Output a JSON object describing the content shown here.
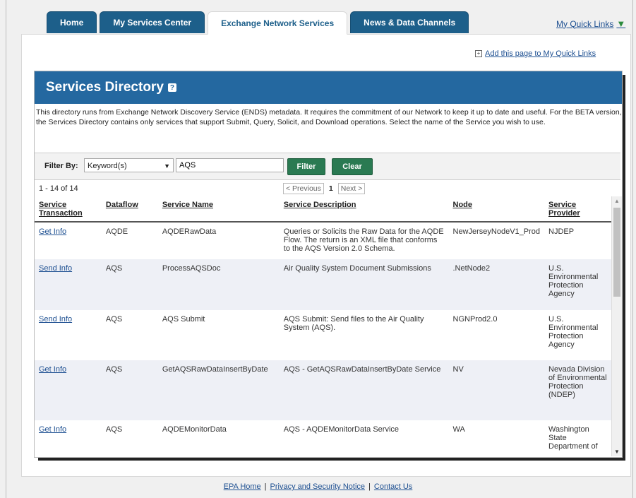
{
  "tabs": [
    {
      "label": "Home",
      "active": false
    },
    {
      "label": "My Services Center",
      "active": false
    },
    {
      "label": "Exchange Network Services",
      "active": true
    },
    {
      "label": "News & Data Channels",
      "active": false
    }
  ],
  "quick_links_label": "My Quick Links",
  "add_page_link": "Add this page to My Quick Links",
  "directory": {
    "title": "Services Directory",
    "help_icon_glyph": "?",
    "intro": "This directory runs from Exchange Network Discovery Service (ENDS) metadata. It requires the commitment of our Network to keep it up to date and useful. For the BETA version, the Services Directory contains only services that support Submit, Query, Solicit, and Download operations. Select the name of the Service you wish to use."
  },
  "filter": {
    "label": "Filter By:",
    "selected_option": "Keyword(s)",
    "keyword_value": "AQS",
    "filter_button": "Filter",
    "clear_button": "Clear"
  },
  "results": {
    "count_text": "1 - 14 of 14",
    "prev": "< Previous",
    "page": "1",
    "next": "Next >"
  },
  "table": {
    "headers": [
      "Service Transaction",
      "Dataflow",
      "Service Name",
      "Service Description",
      "Node",
      "Service Provider"
    ],
    "rows": [
      [
        "Get Info",
        "AQDE",
        "AQDERawData",
        "Queries or Solicits the Raw Data for the AQDE Flow. The return is an XML file that conforms to the AQS Version 2.0 Schema.",
        "NewJerseyNodeV1_Prod",
        "NJDEP"
      ],
      [
        "Send Info",
        "AQS",
        "ProcessAQSDoc",
        "Air Quality System Document Submissions",
        ".NetNode2",
        "U.S. Environmental Protection Agency"
      ],
      [
        "Send Info",
        "AQS",
        "AQS Submit",
        "AQS Submit: Send files to the Air Quality System (AQS).",
        "NGNProd2.0",
        "U.S. Environmental Protection Agency"
      ],
      [
        "Get Info",
        "AQS",
        "GetAQSRawDataInsertByDate",
        "AQS - GetAQSRawDataInsertByDate Service",
        "NV",
        "Nevada Division of Environmental Protection (NDEP)"
      ],
      [
        "Get Info",
        "AQS",
        "AQDEMonitorData",
        "AQS - AQDEMonitorData Service",
        "WA",
        "Washington State Department of"
      ]
    ]
  },
  "footer": {
    "links": [
      "EPA Home",
      "Privacy and Security Notice",
      "Contact Us"
    ],
    "separator": "|"
  },
  "colors": {
    "tab_blue": "#1d5f8a",
    "header_blue": "#2468a0",
    "button_green": "#2a7a52",
    "link_blue": "#1d4f91",
    "arrow_green": "#2a8a3c"
  },
  "icons": {
    "quick_links_arrow": "triangle-down-icon",
    "add_page": "plus-box-icon",
    "select_arrow": "triangle-down-icon",
    "help": "help-icon"
  }
}
